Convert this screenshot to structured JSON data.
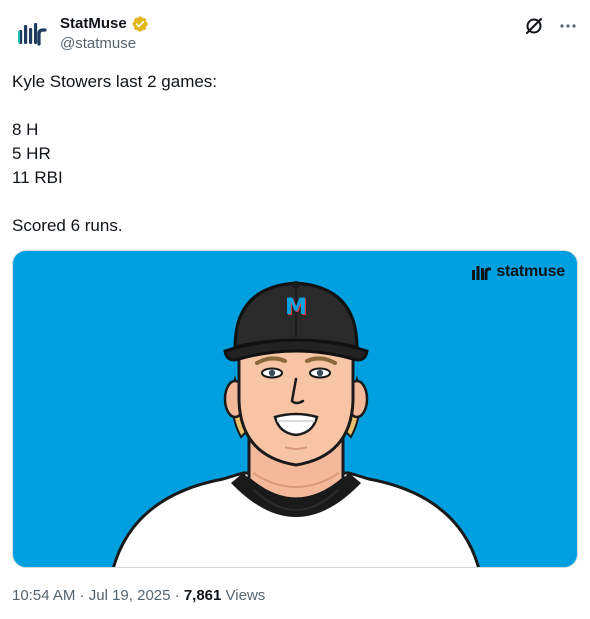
{
  "author": {
    "display_name": "StatMuse",
    "handle": "@statmuse",
    "verified_badge_color": "#e2b719",
    "avatar_icon": "statmuse-bars-logo"
  },
  "tweet": {
    "text": "Kyle Stowers last 2 games:\n\n8 H\n5 HR\n11 RBI\n\nScored 6 runs."
  },
  "media": {
    "background_color": "#009fe0",
    "watermark": "statmuse",
    "cap_logo": "M"
  },
  "meta": {
    "time": "10:54 AM",
    "date": "Jul 19, 2025",
    "views_count": "7,861",
    "views_label": "Views"
  },
  "icons": {
    "top_right": [
      "grok-icon",
      "more-icon"
    ]
  }
}
